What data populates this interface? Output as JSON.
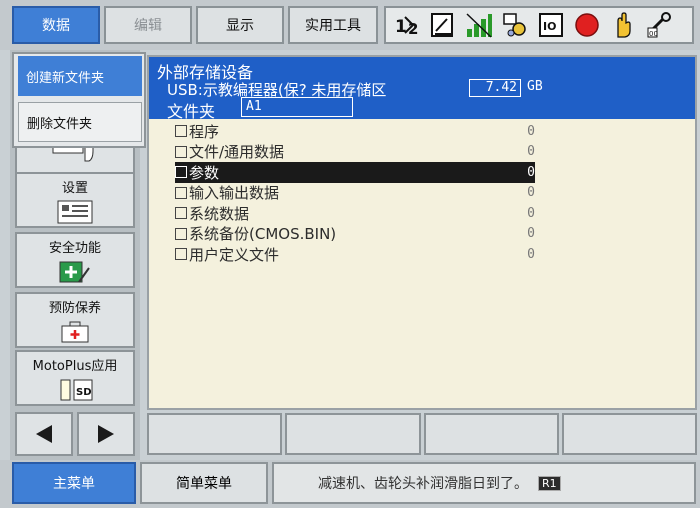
{
  "menubar": {
    "tabs": [
      {
        "label": "数据",
        "state": "active"
      },
      {
        "label": "编辑",
        "state": "disabled"
      },
      {
        "label": "显示",
        "state": "normal"
      },
      {
        "label": "实用工具",
        "state": "normal"
      }
    ],
    "toolbar_icons": [
      "mode-12-icon",
      "edit-doc-icon",
      "signal-bars-icon",
      "tools-icon",
      "io-icon",
      "stop-red-icon",
      "hand-icon",
      "key-icon"
    ]
  },
  "dropdown": {
    "items": [
      {
        "label": "创建新文件夹"
      },
      {
        "label": "删除文件夹"
      }
    ]
  },
  "sidebar": {
    "items": [
      {
        "label": "设置",
        "icon": "settings-panel-icon"
      },
      {
        "label": "安全功能",
        "icon": "safety-icon"
      },
      {
        "label": "预防保养",
        "icon": "maintenance-icon"
      },
      {
        "label": "MotoPlus应用",
        "icon": "sd-card-icon"
      }
    ]
  },
  "header": {
    "title": "外部存储设备",
    "usb_label": "USB:示教编程器(保? 未用存储区",
    "free_space": "7.42",
    "unit": "GB",
    "folder_label": "文件夹",
    "folder_value": "A1"
  },
  "file_list": [
    {
      "name": "程序",
      "count": "0",
      "selected": false
    },
    {
      "name": "文件/通用数据",
      "count": "0",
      "selected": false
    },
    {
      "name": "参数",
      "count": "0",
      "selected": true
    },
    {
      "name": "输入输出数据",
      "count": "0",
      "selected": false
    },
    {
      "name": "系统数据",
      "count": "0",
      "selected": false
    },
    {
      "name": "系统备份(CMOS.BIN)",
      "count": "0",
      "selected": false
    },
    {
      "name": "用户定义文件",
      "count": "0",
      "selected": false
    }
  ],
  "statusbar": {
    "main_menu": "主菜单",
    "simple_menu": "简单菜单",
    "message": "减速机、齿轮头补润滑脂日到了。",
    "tag": "R1"
  },
  "colors": {
    "accent_blue": "#3f7fd6",
    "header_blue": "#1f5fc7",
    "content_bg": "#f4f1dd"
  }
}
